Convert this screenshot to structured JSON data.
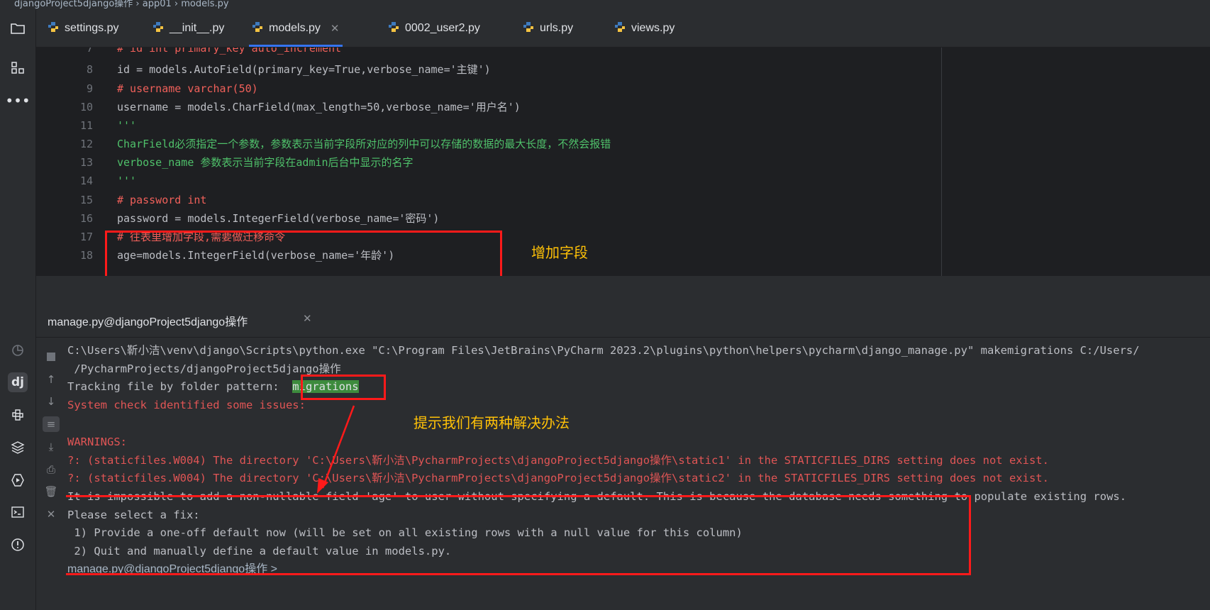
{
  "breadcrumb": {
    "text": "djangoProject5django操作 › app01 › models.py"
  },
  "tabs": [
    {
      "label": "settings.py"
    },
    {
      "label": "__init__.py"
    },
    {
      "label": "models.py",
      "active": true
    },
    {
      "label": "0002_user2.py"
    },
    {
      "label": "urls.py"
    },
    {
      "label": "views.py"
    }
  ],
  "editor": {
    "lines": [
      {
        "n": "7",
        "text": "# id int primary_key auto_increment"
      },
      {
        "n": "8",
        "text": "id = models.AutoField(primary_key=True,verbose_name='主键')"
      },
      {
        "n": "9",
        "text": "# username varchar(50)"
      },
      {
        "n": "10",
        "text": "username = models.CharField(max_length=50,verbose_name='用户名')"
      },
      {
        "n": "11",
        "text": "'''"
      },
      {
        "n": "12",
        "text": "CharField必须指定一个参数，参数表示当前字段所对应的列中可以存储的数据的最大长度，不然会报错"
      },
      {
        "n": "13",
        "text": "verbose_name 参数表示当前字段在admin后台中显示的名字"
      },
      {
        "n": "14",
        "text": "'''"
      },
      {
        "n": "15",
        "text": "# password int"
      },
      {
        "n": "16",
        "text": "password = models.IntegerField(verbose_name='密码')"
      },
      {
        "n": "17",
        "text": "# 往表里增加字段,需要做迁移命令"
      },
      {
        "n": "18",
        "text": "age=models.IntegerField(verbose_name='年龄')"
      }
    ]
  },
  "run": {
    "tab_label": "manage.py@djangoProject5django操作"
  },
  "console": {
    "line1": "C:\\Users\\靳小洁\\venv\\django\\Scripts\\python.exe \"C:\\Program Files\\JetBrains\\PyCharm 2023.2\\plugins\\python\\helpers\\pycharm\\django_manage.py\" makemigrations C:/Users/",
    "line2": " /PycharmProjects/djangoProject5django操作",
    "line3_prefix": "Tracking file by folder pattern:  ",
    "line3_hl": "migrations",
    "line4": "System check identified some issues:",
    "line5": "WARNINGS:",
    "line6": "?: (staticfiles.W004) The directory 'C:\\Users\\靳小洁\\PycharmProjects\\djangoProject5django操作\\static1' in the STATICFILES_DIRS setting does not exist.",
    "line7": "?: (staticfiles.W004) The directory 'C:\\Users\\靳小洁\\PycharmProjects\\djangoProject5django操作\\static2' in the STATICFILES_DIRS setting does not exist.",
    "line8": "It is impossible to add a non-nullable field 'age' to user without specifying a default. This is because the database needs something to populate existing rows.",
    "line9": "Please select a fix:",
    "line10": " 1) Provide a one-off default now (will be set on all existing rows with a null value for this column)",
    "line11": " 2) Quit and manually define a default value in models.py.",
    "prompt": "manage.py@djangoProject5django操作 >"
  },
  "annotations": {
    "add_field": "增加字段",
    "two_solutions": "提示我们有两种解决办法"
  },
  "colors": {
    "highlight_box": "#ff1a1a",
    "annotation_text": "#ffc107",
    "accent": "#3574f0"
  }
}
